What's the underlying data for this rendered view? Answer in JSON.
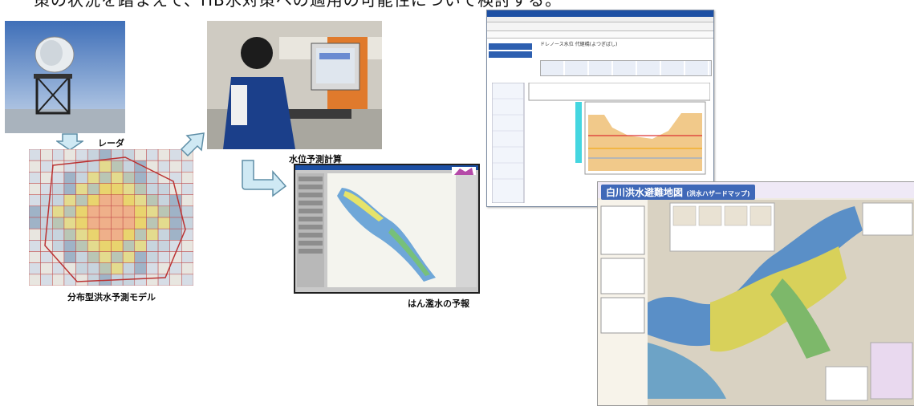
{
  "header": {
    "text": "策の状況を踏まえて、HB水対策への適用の可能性について検討する。"
  },
  "captions": {
    "radar": "レーダ",
    "model": "分布型洪水予測モデル",
    "water_level": "水位予測計算",
    "inundation": "はん濫水の予報"
  },
  "hazard_map": {
    "title": "白川洪水避難地図",
    "subtitle": "(洪水ハザードマップ)"
  },
  "browser": {
    "page_title": "ドレノース水位 代継橋(よつぎばし)"
  }
}
